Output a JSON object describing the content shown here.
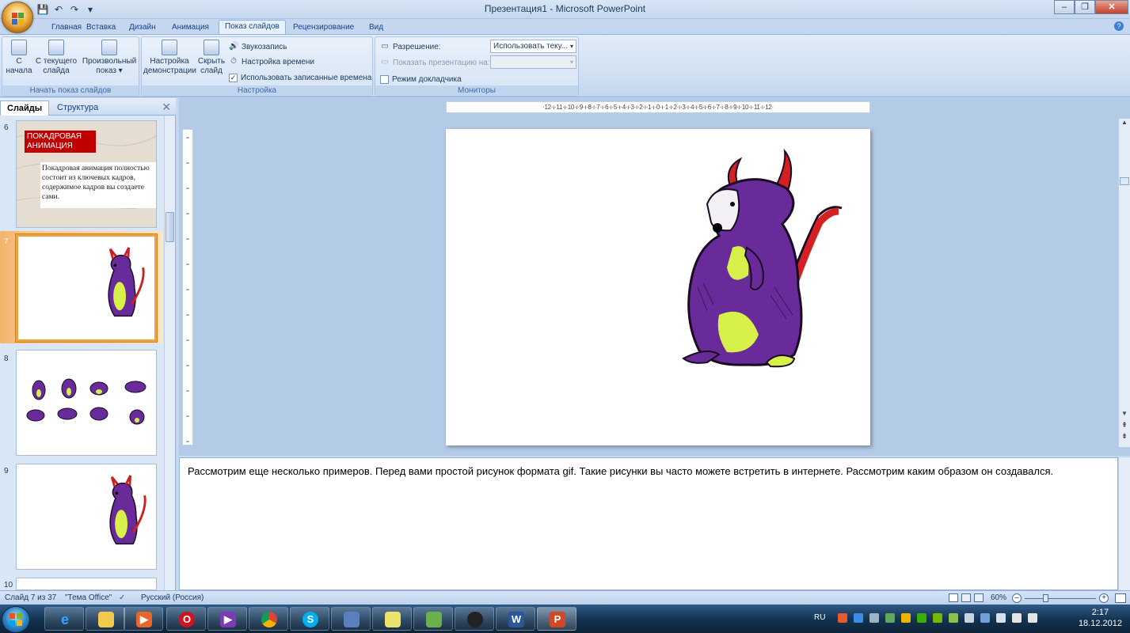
{
  "window": {
    "title": "Презентация1 - Microsoft PowerPoint"
  },
  "ribbon_tabs": [
    "Главная",
    "Вставка",
    "Дизайн",
    "Анимация",
    "Показ слайдов",
    "Рецензирование",
    "Вид"
  ],
  "active_tab": "Показ слайдов",
  "ribbon": {
    "group1": {
      "label": "Начать показ слайдов",
      "btn_from_start": [
        "С",
        "начала"
      ],
      "btn_from_current": [
        "С текущего",
        "слайда"
      ],
      "btn_custom": [
        "Произвольный",
        "показ ▾"
      ]
    },
    "group2": {
      "label": "Настройка",
      "btn_setup": [
        "Настройка",
        "демонстрации"
      ],
      "btn_hide": [
        "Скрыть",
        "слайд"
      ],
      "record": "Звукозапись",
      "timings": "Настройка времени",
      "use_timings": "Использовать записанные времена"
    },
    "group3": {
      "label": "Мониторы",
      "resolution_label": "Разрешение:",
      "resolution_value": "Использовать теку...",
      "show_on_label": "Показать презентацию на:",
      "presenter_view": "Режим докладчика"
    }
  },
  "pane": {
    "tab_slides": "Слайды",
    "tab_outline": "Структура",
    "close": "✕"
  },
  "thumbnails": [
    {
      "num": "6",
      "title_line1": "ПОКАДРОВАЯ",
      "title_line2": "АНИМАЦИЯ",
      "body": "Покадровая анимация полностью состоит из ключевых кадров, содержимое кадров вы создаете сами."
    },
    {
      "num": "7"
    },
    {
      "num": "8"
    },
    {
      "num": "9"
    },
    {
      "num": "10"
    }
  ],
  "ruler": {
    "horizontal": "·12·ı·11·ı·10·ı·9·ı·8·ı·7·ı·6·ı·5·ı·4·ı·3·ı·2·ı·1·ı·0·ı·1·ı·2·ı·3·ı·4·ı·5·ı·6·ı·7·ı·8·ı·9·ı·10·ı·11·ı·12·"
  },
  "notes": {
    "text": "Рассмотрим еще несколько примеров. Перед вами простой рисунок формата gif. Такие рисунки вы часто можете встретить в интернете. Рассмотрим каким образом он создавался."
  },
  "statusbar": {
    "slide_info": "Слайд 7 из 37",
    "theme": "\"Тема Office\"",
    "language": "Русский (Россия)",
    "zoom": "60%"
  },
  "taskbar": {
    "lang": "RU",
    "time": "2:17",
    "date": "18.12.2012"
  },
  "colors": {
    "accent": "#15428b",
    "selected_slide": "#f1a040",
    "slide6_title_bg": "#c00000"
  }
}
